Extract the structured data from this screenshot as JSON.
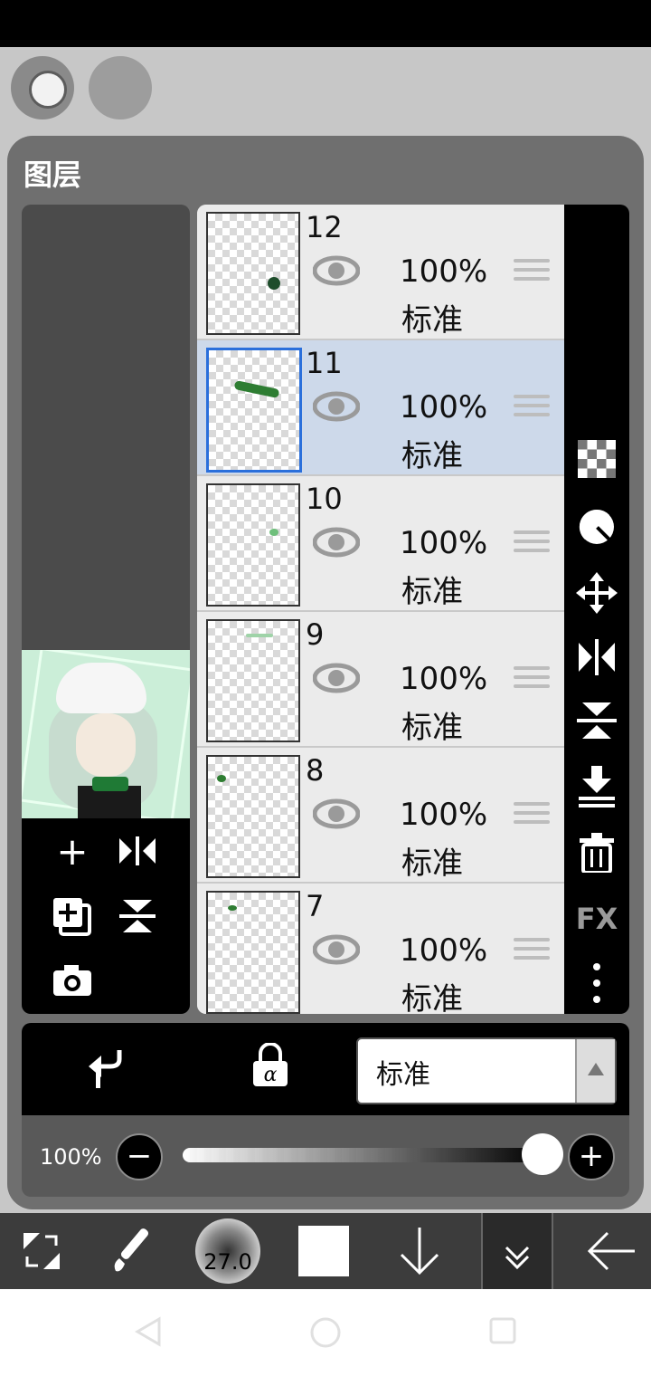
{
  "panel": {
    "title": "图层"
  },
  "layers": [
    {
      "number": "12",
      "opacity": "100%",
      "blend": "标准",
      "selected": false
    },
    {
      "number": "11",
      "opacity": "100%",
      "blend": "标准",
      "selected": true
    },
    {
      "number": "10",
      "opacity": "100%",
      "blend": "标准",
      "selected": false
    },
    {
      "number": "9",
      "opacity": "100%",
      "blend": "标准",
      "selected": false
    },
    {
      "number": "8",
      "opacity": "100%",
      "blend": "标准",
      "selected": false
    },
    {
      "number": "7",
      "opacity": "100%",
      "blend": "标准",
      "selected": false
    }
  ],
  "right_tools": [
    "checker-icon",
    "circle-half-icon",
    "move-icon",
    "flip-horizontal-icon",
    "flip-vertical-icon",
    "merge-down-icon",
    "trash-icon",
    "fx-icon",
    "more-vertical-icon"
  ],
  "fx_label": "FX",
  "left_tools": [
    "add-layer-icon",
    "flip-layer-icon",
    "duplicate-layer-icon",
    "flip-vertical-icon",
    "camera-icon"
  ],
  "blend_mode": {
    "value": "标准"
  },
  "opacity": {
    "label": "100%",
    "value_fraction": 1.0
  },
  "toolbar": {
    "brush_size": "27.0"
  },
  "colors": {
    "selected_row": "#cdd9ea",
    "selected_border": "#2a6fdb",
    "panel": "#6f6f6f"
  }
}
